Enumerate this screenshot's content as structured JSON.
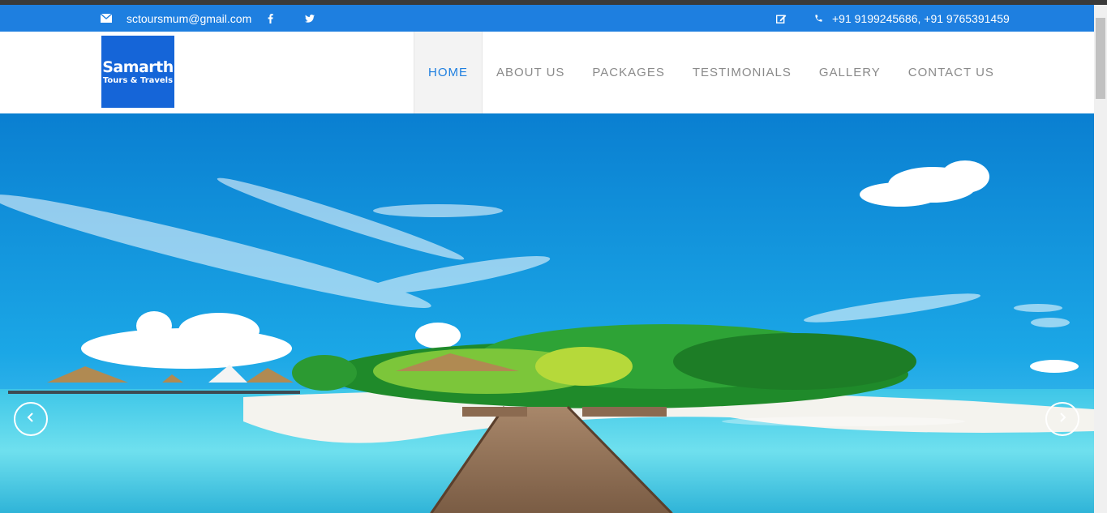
{
  "colors": {
    "topbar": "#1e7fe0",
    "logo_bg": "#1565d8",
    "nav_active": "#1e7fe0",
    "nav_text": "#8a8a8a"
  },
  "topbar": {
    "email": "sctoursmum@gmail.com",
    "phones": "+91 9199245686, +91 9765391459",
    "icons": [
      "envelope-icon",
      "facebook-icon",
      "twitter-icon",
      "edit-icon",
      "phone-icon"
    ]
  },
  "logo": {
    "line1": "Samarth",
    "line2": "Tours & Travels"
  },
  "nav": {
    "items": [
      {
        "label": "HOME",
        "active": true
      },
      {
        "label": "ABOUT US",
        "active": false
      },
      {
        "label": "PACKAGES",
        "active": false
      },
      {
        "label": "TESTIMONIALS",
        "active": false
      },
      {
        "label": "GALLERY",
        "active": false
      },
      {
        "label": "CONTACT US",
        "active": false
      }
    ]
  },
  "carousel": {
    "prev_icon": "chevron-left-icon",
    "next_icon": "chevron-right-icon"
  }
}
